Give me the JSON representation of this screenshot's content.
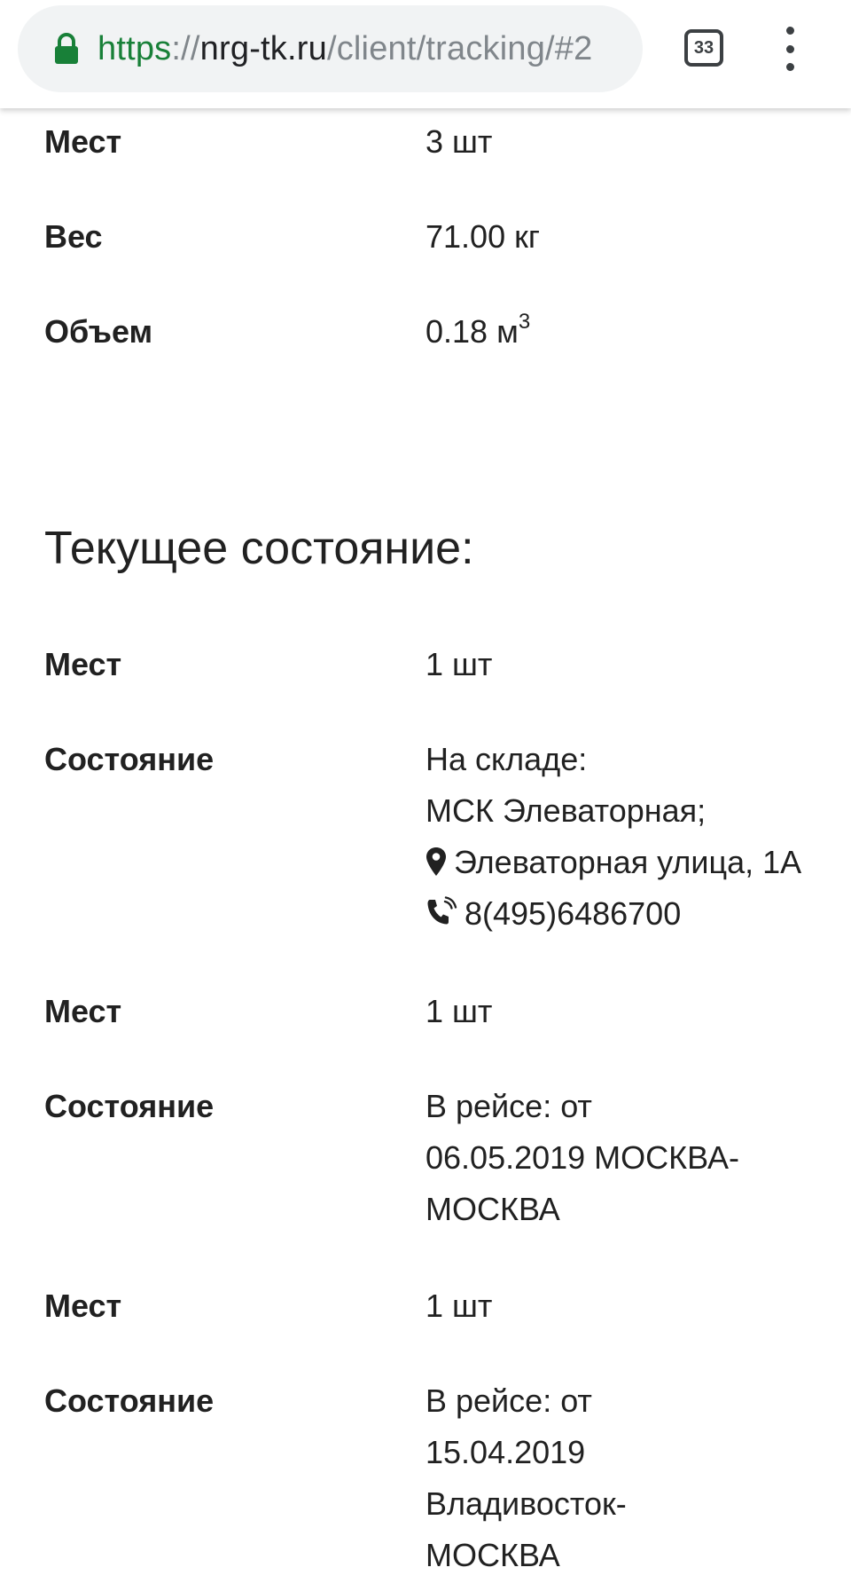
{
  "browser": {
    "url_scheme": "https",
    "url_sep": "://",
    "url_host": "nrg-tk.ru",
    "url_path": "/client/tracking/#2",
    "tab_count": "33",
    "lock_icon": "lock-icon",
    "menu_icon": "more-vert-icon"
  },
  "shipment": {
    "places_label": "Мест",
    "places_value": "3 шт",
    "weight_label": "Вес",
    "weight_value": "71.00 кг",
    "volume_label": "Объем",
    "volume_value": "0.18 м",
    "volume_unit_sup": "3"
  },
  "current_state": {
    "title": "Текущее состояние:",
    "entries": [
      {
        "places_label": "Мест",
        "places_value": "1 шт",
        "state_label": "Состояние",
        "state_lines": [
          "На складе:",
          "МСК Элеваторная;",
          "Элеваторная улица, 1А",
          "8(495)6486700"
        ]
      },
      {
        "places_label": "Мест",
        "places_value": "1 шт",
        "state_label": "Состояние",
        "state_lines": [
          "В рейсе: от",
          "06.05.2019 МОСКВА-",
          "МОСКВА"
        ]
      },
      {
        "places_label": "Мест",
        "places_value": "1 шт",
        "state_label": "Состояние",
        "state_lines": [
          "В рейсе: от",
          "15.04.2019",
          "Владивосток-",
          "МОСКВА"
        ]
      }
    ]
  },
  "colors": {
    "scheme_green": "#188038",
    "text": "#212121",
    "url_grey": "#80868b"
  }
}
